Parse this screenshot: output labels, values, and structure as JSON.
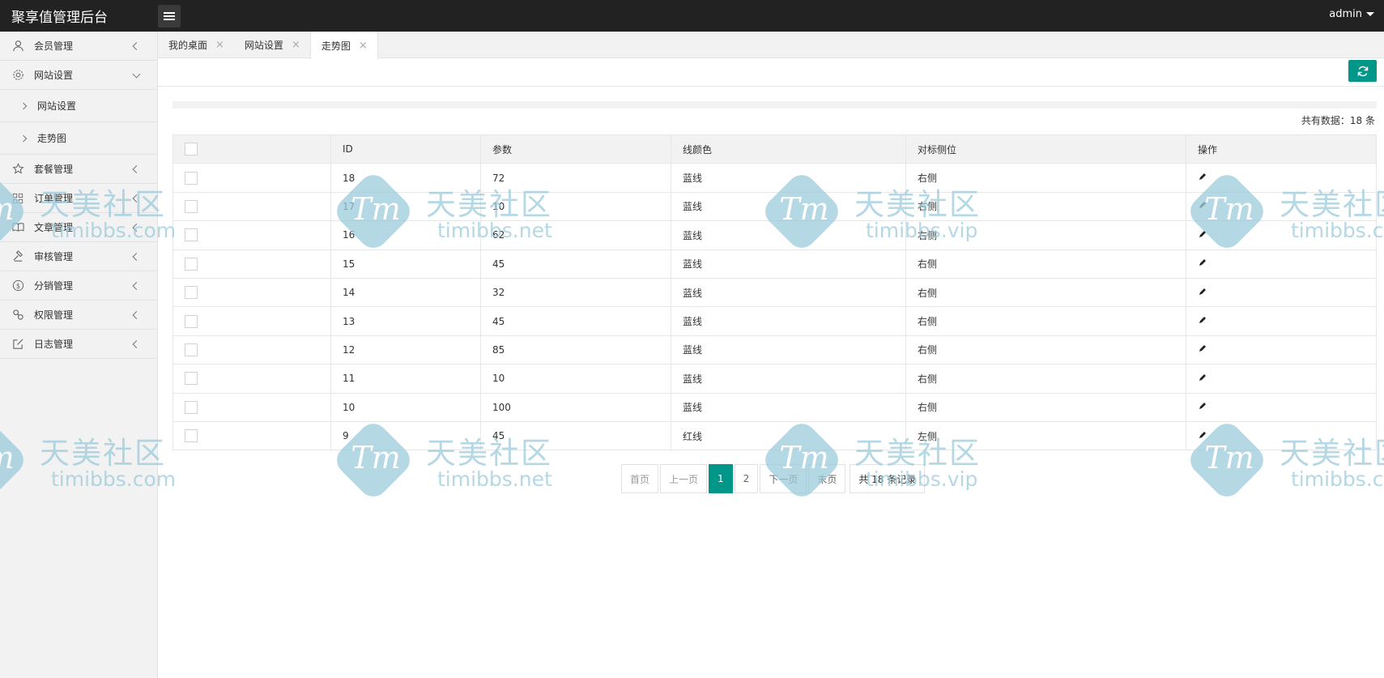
{
  "header": {
    "brand": "聚享值管理后台",
    "user": "admin"
  },
  "sidebar": {
    "items": [
      {
        "label": "会员管理",
        "icon": "user-icon"
      },
      {
        "label": "网站设置",
        "icon": "gear-icon",
        "expanded": true,
        "children": [
          {
            "label": "网站设置"
          },
          {
            "label": "走势图"
          }
        ]
      },
      {
        "label": "套餐管理",
        "icon": "star-icon"
      },
      {
        "label": "订单管理",
        "icon": "grid-icon"
      },
      {
        "label": "文章管理",
        "icon": "book-icon"
      },
      {
        "label": "审核管理",
        "icon": "hammer-icon"
      },
      {
        "label": "分销管理",
        "icon": "dollar-icon"
      },
      {
        "label": "权限管理",
        "icon": "link-icon"
      },
      {
        "label": "日志管理",
        "icon": "edit-square-icon"
      }
    ]
  },
  "tabs": [
    {
      "label": "我的桌面",
      "close": "×"
    },
    {
      "label": "网站设置",
      "close": "×"
    },
    {
      "label": "走势图",
      "close": "×",
      "active": true
    }
  ],
  "summary": {
    "total_label": "共有数据：18 条"
  },
  "table": {
    "headers": [
      "",
      "ID",
      "参数",
      "线颜色",
      "对标侧位",
      "操作"
    ],
    "rows": [
      {
        "id": "18",
        "param": "72",
        "color": "蓝线",
        "side": "右侧"
      },
      {
        "id": "17",
        "param": "10",
        "color": "蓝线",
        "side": "右侧"
      },
      {
        "id": "16",
        "param": "62",
        "color": "蓝线",
        "side": "右侧"
      },
      {
        "id": "15",
        "param": "45",
        "color": "蓝线",
        "side": "右侧"
      },
      {
        "id": "14",
        "param": "32",
        "color": "蓝线",
        "side": "右侧"
      },
      {
        "id": "13",
        "param": "45",
        "color": "蓝线",
        "side": "右侧"
      },
      {
        "id": "12",
        "param": "85",
        "color": "蓝线",
        "side": "右侧"
      },
      {
        "id": "11",
        "param": "10",
        "color": "蓝线",
        "side": "右侧"
      },
      {
        "id": "10",
        "param": "100",
        "color": "蓝线",
        "side": "右侧"
      },
      {
        "id": "9",
        "param": "45",
        "color": "红线",
        "side": "左侧"
      }
    ]
  },
  "pagination": {
    "first": "首页",
    "prev": "上一页",
    "current": "1",
    "page2": "2",
    "next": "下一页",
    "last": "末页",
    "count": "共 18 条记录"
  },
  "watermarks": [
    {
      "cn": "天美社区",
      "en": "timibbs.com",
      "logo": "Tm"
    },
    {
      "cn": "天美社区",
      "en": "timibbs.net",
      "logo": "Tm"
    },
    {
      "cn": "天美社区",
      "en": "timibbs.vip",
      "logo": "Tm"
    }
  ],
  "colors": {
    "header_bg": "#222222",
    "accent": "#009688",
    "sidebar_bg": "#f2f2f2",
    "watermark": "#9ccbdc"
  }
}
